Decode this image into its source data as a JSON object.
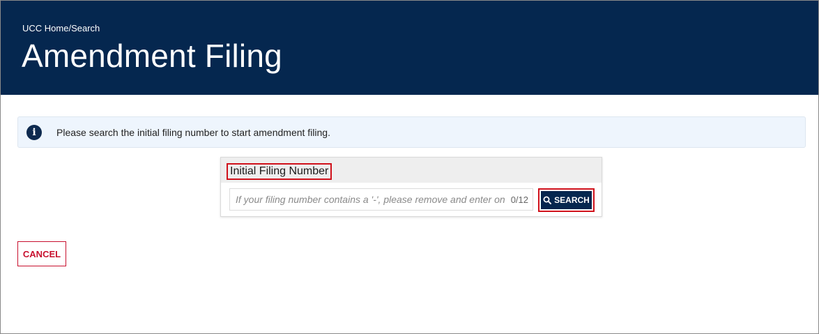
{
  "header": {
    "breadcrumb": "UCC Home/Search",
    "title": "Amendment Filing"
  },
  "info_banner": {
    "icon": "info-icon",
    "message": "Please search the initial filing number to start amendment filing."
  },
  "search_card": {
    "title": "Initial Filing Number",
    "input": {
      "value": "",
      "placeholder": "If your filing number contains a '-', please remove and enter only r",
      "char_count": "0/12"
    },
    "search_button": {
      "icon": "search-icon",
      "label": "SEARCH"
    }
  },
  "cancel_button": {
    "label": "CANCEL"
  },
  "colors": {
    "header_bg": "#05274f",
    "banner_bg": "#eef5fd",
    "highlight_outline": "#d0111b",
    "cancel_red": "#c8102e"
  }
}
